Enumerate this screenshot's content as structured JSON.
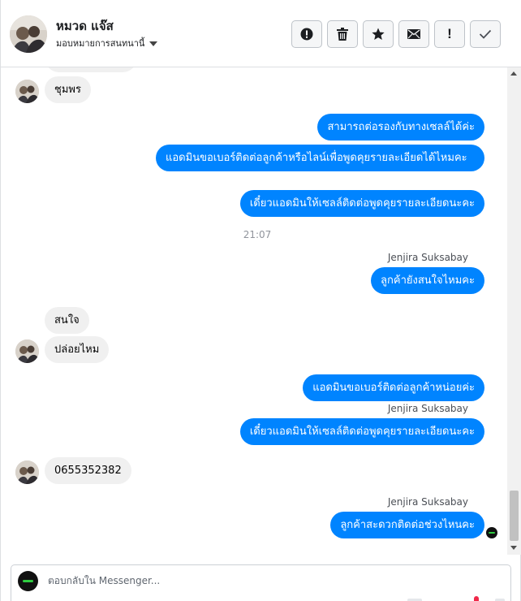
{
  "header": {
    "customer_name": "หมวด แจ๊ส",
    "assign_label": "มอบหมายการสนทนานี้",
    "toolbar": [
      {
        "name": "spam-button",
        "icon": "alert-circle-icon"
      },
      {
        "name": "delete-button",
        "icon": "trash-icon"
      },
      {
        "name": "star-button",
        "icon": "star-icon"
      },
      {
        "name": "mark-unread-button",
        "icon": "envelope-icon"
      },
      {
        "name": "follow-up-button",
        "icon": "exclamation-icon"
      },
      {
        "name": "mark-done-button",
        "icon": "check-icon"
      }
    ]
  },
  "thread": {
    "messages": [
      {
        "dir": "in",
        "text": "ชุมพร"
      },
      {
        "dir": "out",
        "text": "สามารถต่อรองกับทางเซลล์ได้ค่ะ"
      },
      {
        "dir": "out",
        "text": "แอดมินขอเบอร์ติดต่อลูกค้าหรือไลน์เพื่อพูดคุยรายละเอียดได้ไหมคะ"
      },
      {
        "dir": "out",
        "text": "เดี๋ยวแอดมินให้เซลล์ติดต่อพูดคุยรายละเอียดนะคะ"
      },
      {
        "dir": "out",
        "text": "ลูกค้ายังสนใจไหมคะ"
      },
      {
        "dir": "in",
        "text": "สนใจ"
      },
      {
        "dir": "in",
        "text": "ปล่อยไหม"
      },
      {
        "dir": "out",
        "text": "แอดมินขอเบอร์ติดต่อลูกค้าหน่อยค่ะ"
      },
      {
        "dir": "out",
        "text": "เดี๋ยวแอดมินให้เซลล์ติดต่อพูดคุยรายละเอียดนะคะ"
      },
      {
        "dir": "in",
        "text": "0655352382"
      },
      {
        "dir": "out",
        "text": "ลูกค้าสะดวกติดต่อช่วงไหนคะ"
      }
    ],
    "timestamp": "21:07",
    "agent_name": "Jenjira Suksabay"
  },
  "composer": {
    "placeholder": "ตอบกลับใน Messenger..."
  },
  "colors": {
    "outgoing_bubble": "#0084ff",
    "incoming_bubble": "#f0f0f0"
  }
}
